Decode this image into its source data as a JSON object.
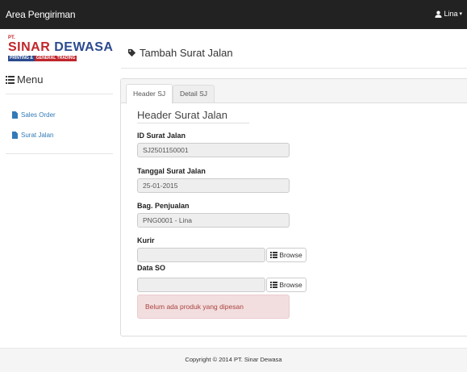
{
  "navbar": {
    "brand": "Area Pengiriman",
    "user_name": "Lina"
  },
  "logo": {
    "pt": "PT.",
    "word1": "SINAR",
    "word2": "DEWASA",
    "strip1": "PRINTING &",
    "strip2": "GENERAL TRADING"
  },
  "page": {
    "title": "Tambah Surat Jalan"
  },
  "sidebar": {
    "title": "Menu",
    "items": [
      {
        "label": "Sales Order",
        "icon": "file-icon"
      },
      {
        "label": "Surat Jalan",
        "icon": "file-icon"
      }
    ]
  },
  "tabs": [
    {
      "label": "Header SJ",
      "active": true
    },
    {
      "label": "Detail SJ",
      "active": false
    }
  ],
  "form": {
    "title": "Header Surat Jalan",
    "id_label": "ID Surat Jalan",
    "id_value": "SJ2501150001",
    "tanggal_label": "Tanggal Surat Jalan",
    "tanggal_value": "25-01-2015",
    "bag_label": "Bag. Penjualan",
    "bag_value": "PNG0001 - Lina",
    "kurir_label": "Kurir",
    "kurir_value": "",
    "dataso_label": "Data SO",
    "dataso_value": "",
    "browse_label": "Browse",
    "alert_text": "Belum ada produk yang dipesan"
  },
  "footer": {
    "text": "Copyright © 2014 PT. Sinar Dewasa"
  },
  "colors": {
    "navbar_bg": "#222222",
    "link": "#337ab7",
    "alert_bg": "#f2dede",
    "alert_text": "#a94442",
    "logo_red": "#c0262c",
    "logo_blue": "#2b4a8f"
  }
}
